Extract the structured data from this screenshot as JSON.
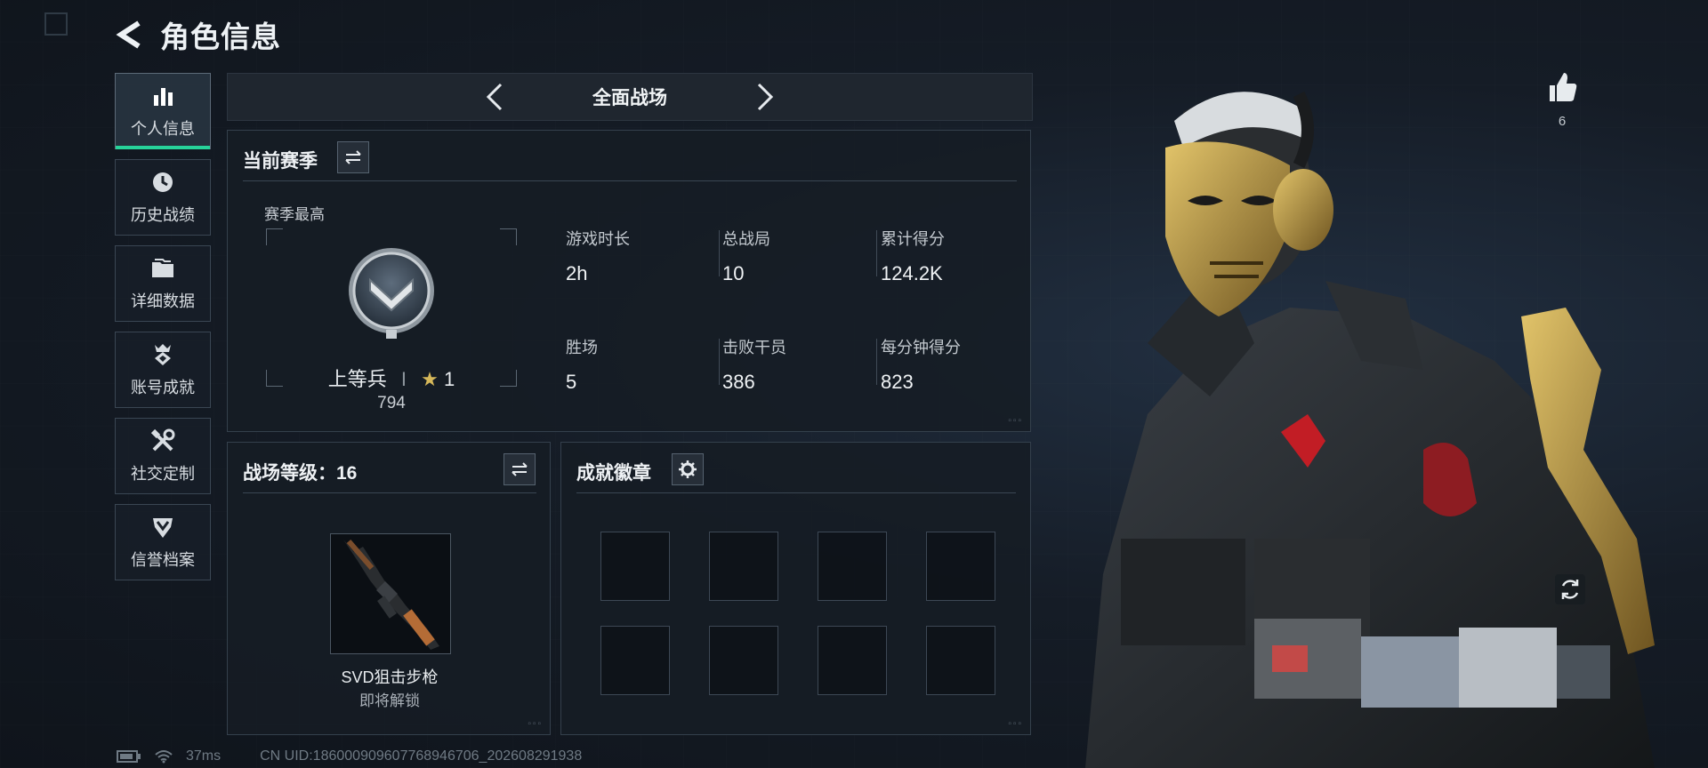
{
  "header": {
    "title": "角色信息"
  },
  "sidebar": {
    "items": [
      {
        "label": "个人信息",
        "icon": "bar-chart-icon",
        "active": true
      },
      {
        "label": "历史战绩",
        "icon": "clock-icon"
      },
      {
        "label": "详细数据",
        "icon": "folder-icon"
      },
      {
        "label": "账号成就",
        "icon": "achievement-icon"
      },
      {
        "label": "社交定制",
        "icon": "tools-icon"
      },
      {
        "label": "信誉档案",
        "icon": "credit-shield-icon"
      }
    ]
  },
  "mode": {
    "title": "全面战场"
  },
  "season": {
    "title": "当前赛季",
    "best_label": "赛季最高",
    "rank_name": "上等兵",
    "rank_separator": "I",
    "rank_stars": "1",
    "rank_points": "794",
    "stats": [
      {
        "label": "游戏时长",
        "value": "2h"
      },
      {
        "label": "总战局",
        "value": "10"
      },
      {
        "label": "累计得分",
        "value": "124.2K"
      },
      {
        "label": "胜场",
        "value": "5"
      },
      {
        "label": "击败干员",
        "value": "386"
      },
      {
        "label": "每分钟得分",
        "value": "823"
      }
    ]
  },
  "level": {
    "title": "战场等级：16",
    "weapon_name": "SVD狙击步枪",
    "weapon_status": "即将解锁"
  },
  "badges": {
    "title": "成就徽章"
  },
  "status_bar": {
    "ping": "37ms",
    "uid": "CN UID:1860009096077689467​06_202608291938"
  },
  "character": {
    "like_count": "6"
  },
  "colors": {
    "accent": "#27d39a",
    "gold": "#c9a548",
    "panel": "#161c24"
  }
}
